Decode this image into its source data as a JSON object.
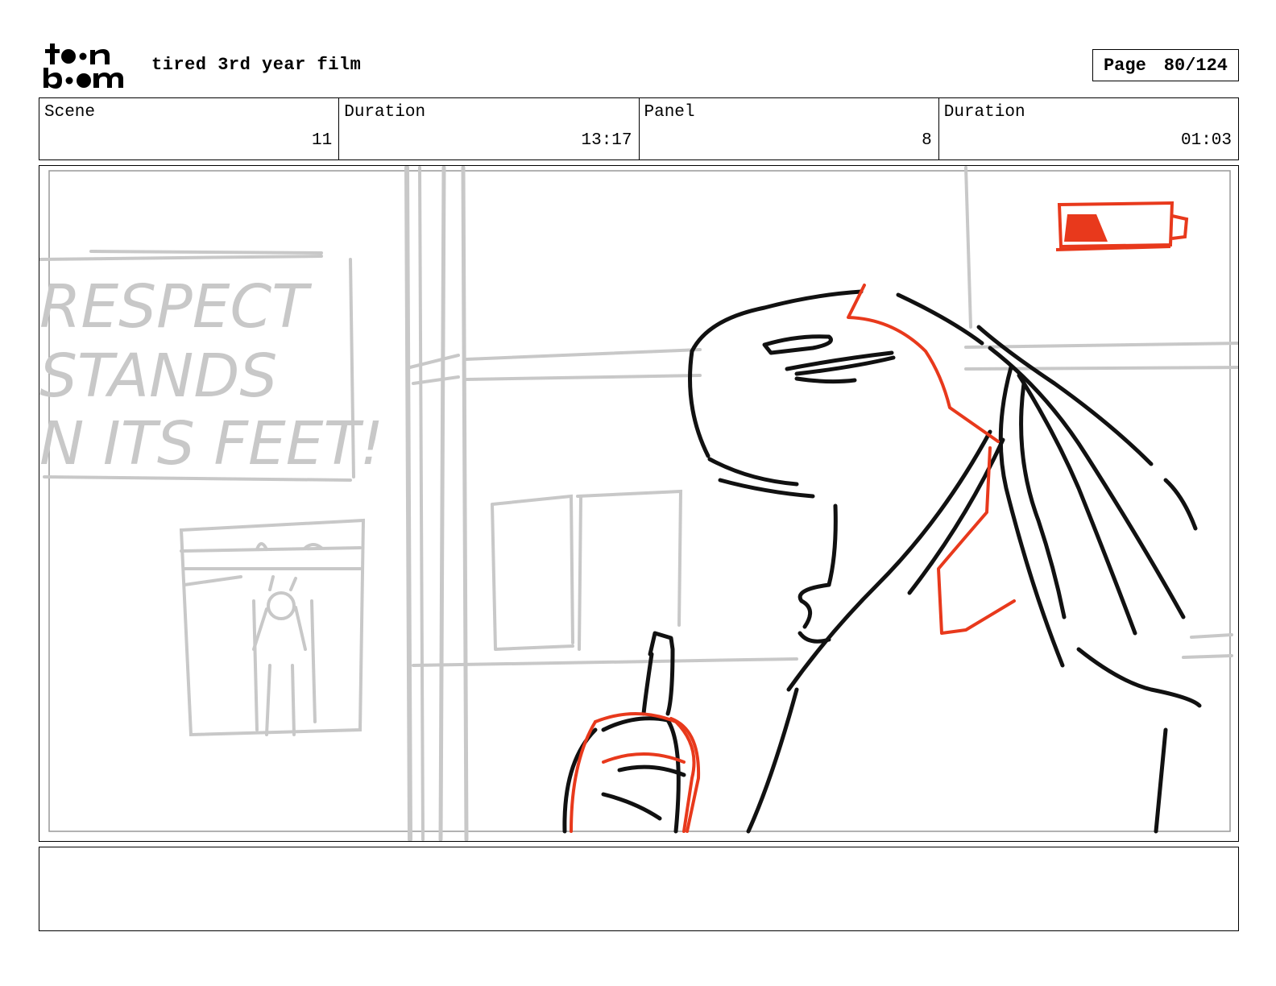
{
  "header": {
    "logo_line1": "toon",
    "logo_line2": "boom",
    "title": "tired 3rd year film",
    "page_label": "Page",
    "page_value": "80/124"
  },
  "info": {
    "scene_label": "Scene",
    "scene_value": "11",
    "scene_duration_label": "Duration",
    "scene_duration_value": "13:17",
    "panel_label": "Panel",
    "panel_value": "8",
    "panel_duration_label": "Duration",
    "panel_duration_value": "01:03"
  },
  "panel": {
    "sign_line1": "RESPECT",
    "sign_line2": "STANDS",
    "sign_line3": "N ITS FEET!",
    "battery_level": 0.3,
    "colors": {
      "sketch_black": "#111111",
      "sketch_red": "#e8391c",
      "background_gray": "#c8c8c8"
    }
  },
  "notes": {
    "text": ""
  }
}
